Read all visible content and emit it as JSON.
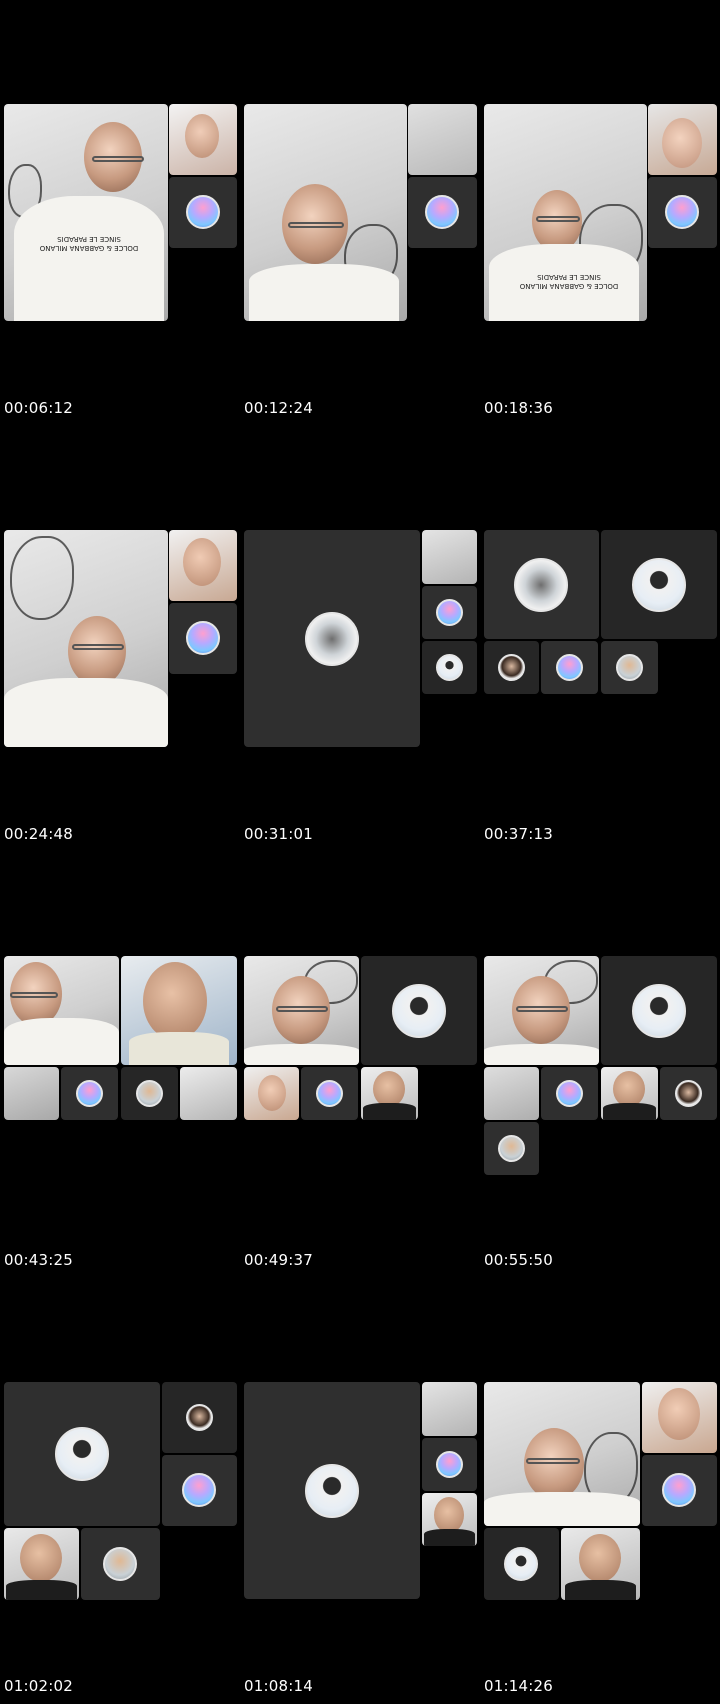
{
  "timestamps": [
    "00:06:12",
    "00:12:24",
    "00:18:36",
    "00:24:48",
    "00:31:01",
    "00:37:13",
    "00:43:25",
    "00:49:37",
    "00:55:50",
    "01:02:02",
    "01:08:14",
    "01:14:26"
  ],
  "shirt_text": {
    "frame1": "DOLCE & GABBANA MILANO SINCE LE PARADIS",
    "frame3": "DOLCE & GABBANA MILANO SINCE LE PARADIS"
  }
}
